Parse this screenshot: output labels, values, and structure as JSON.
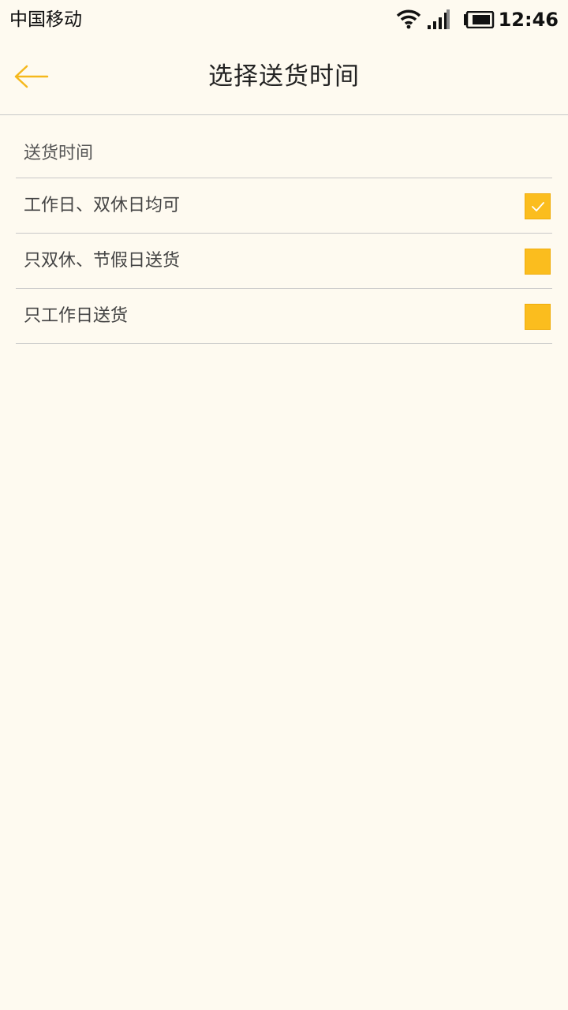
{
  "status_bar": {
    "carrier": "中国移动",
    "time": "12:46",
    "icons": [
      "wifi-icon",
      "signal-icon",
      "battery-icon"
    ]
  },
  "header": {
    "back_icon": "arrow-left-icon",
    "title": "选择送货时间"
  },
  "section": {
    "title": "送货时间"
  },
  "options": [
    {
      "label": "工作日、双休日均可",
      "checked": true
    },
    {
      "label": "只双休、节假日送货",
      "checked": false
    },
    {
      "label": "只工作日送货",
      "checked": false
    }
  ],
  "colors": {
    "background": "#fefaf0",
    "accent": "#fbbd1e",
    "divider": "#c8c8c8"
  }
}
